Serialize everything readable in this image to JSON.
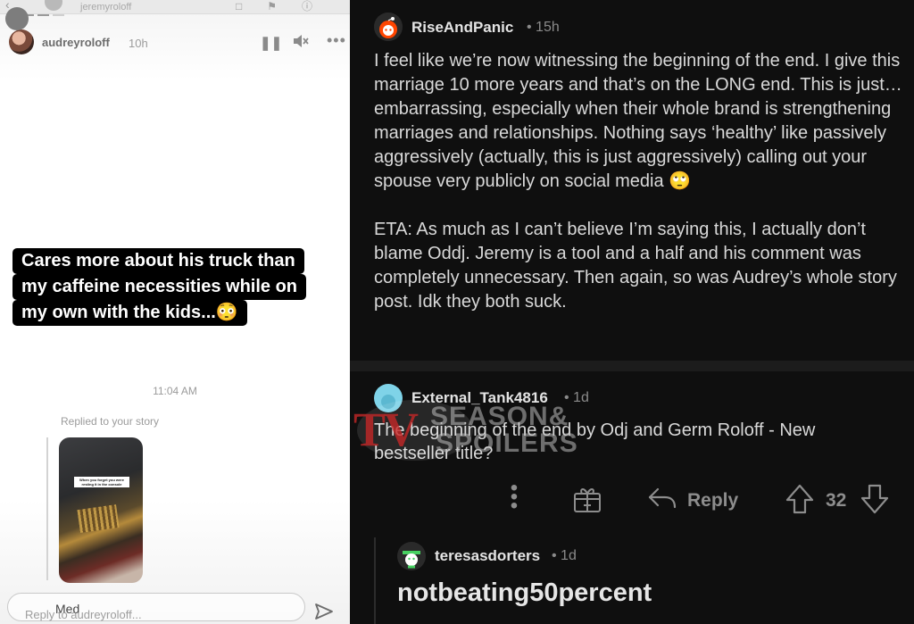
{
  "story": {
    "ghost_header_username": "jeremyroloff",
    "username": "audreyroloff",
    "time": "10h",
    "caption_lines": [
      "Cares more about his truck than",
      "my caffeine necessities while on",
      "my own with the kids...😳"
    ],
    "message_time": "11:04 AM",
    "replied_label": "Replied to your story",
    "thumbnail_caption": "When you forget you were resting it in the console",
    "reply_placeholder": "Reply to audreyroloff...",
    "reply_ghost_text": "Med",
    "icons": {
      "pause": "pause-icon",
      "mute": "mute-icon",
      "more": "more-icon",
      "send": "send-icon"
    }
  },
  "thread": {
    "comment_1": {
      "username": "RiseAndPanic",
      "meta": "• 15h",
      "paragraphs": [
        "I feel like we’re now witnessing the beginning of the end. I give this marriage 10 more years and that’s on the LONG end. This is just…embarrassing, especially when their whole brand is strengthening marriages and relationships. Nothing says ‘healthy’ like passively aggressively (actually, this is just aggressively) calling out your spouse very publicly on social media 🙄",
        "ETA: As much as I can’t believe I’m saying this, I actually don’t blame Oddj. Jeremy is a tool and a half and his comment was completely unnecessary. Then again, so was Audrey’s whole story post. Idk they both suck."
      ]
    },
    "comment_2": {
      "username": "External_Tank4816",
      "meta": "• 1d",
      "body": "The beginning of the end by Odj and Germ Roloff - New bestseller title?"
    },
    "actions": {
      "reply_label": "Reply",
      "score": "32"
    },
    "comment_3": {
      "username": "teresasdorters",
      "meta": "• 1d",
      "body": "notbeating50percent"
    },
    "watermark": {
      "brand": "TV",
      "line1": "SEASON&",
      "line2": "SPOILERS"
    },
    "colors": {
      "background": "#0f0f0f",
      "text": "#d9d9d9",
      "muted": "#8a8a8a",
      "avatar_orange": "#ff4500",
      "avatar_teal": "#7fd3e8",
      "avatar_green": "#46d160"
    }
  }
}
